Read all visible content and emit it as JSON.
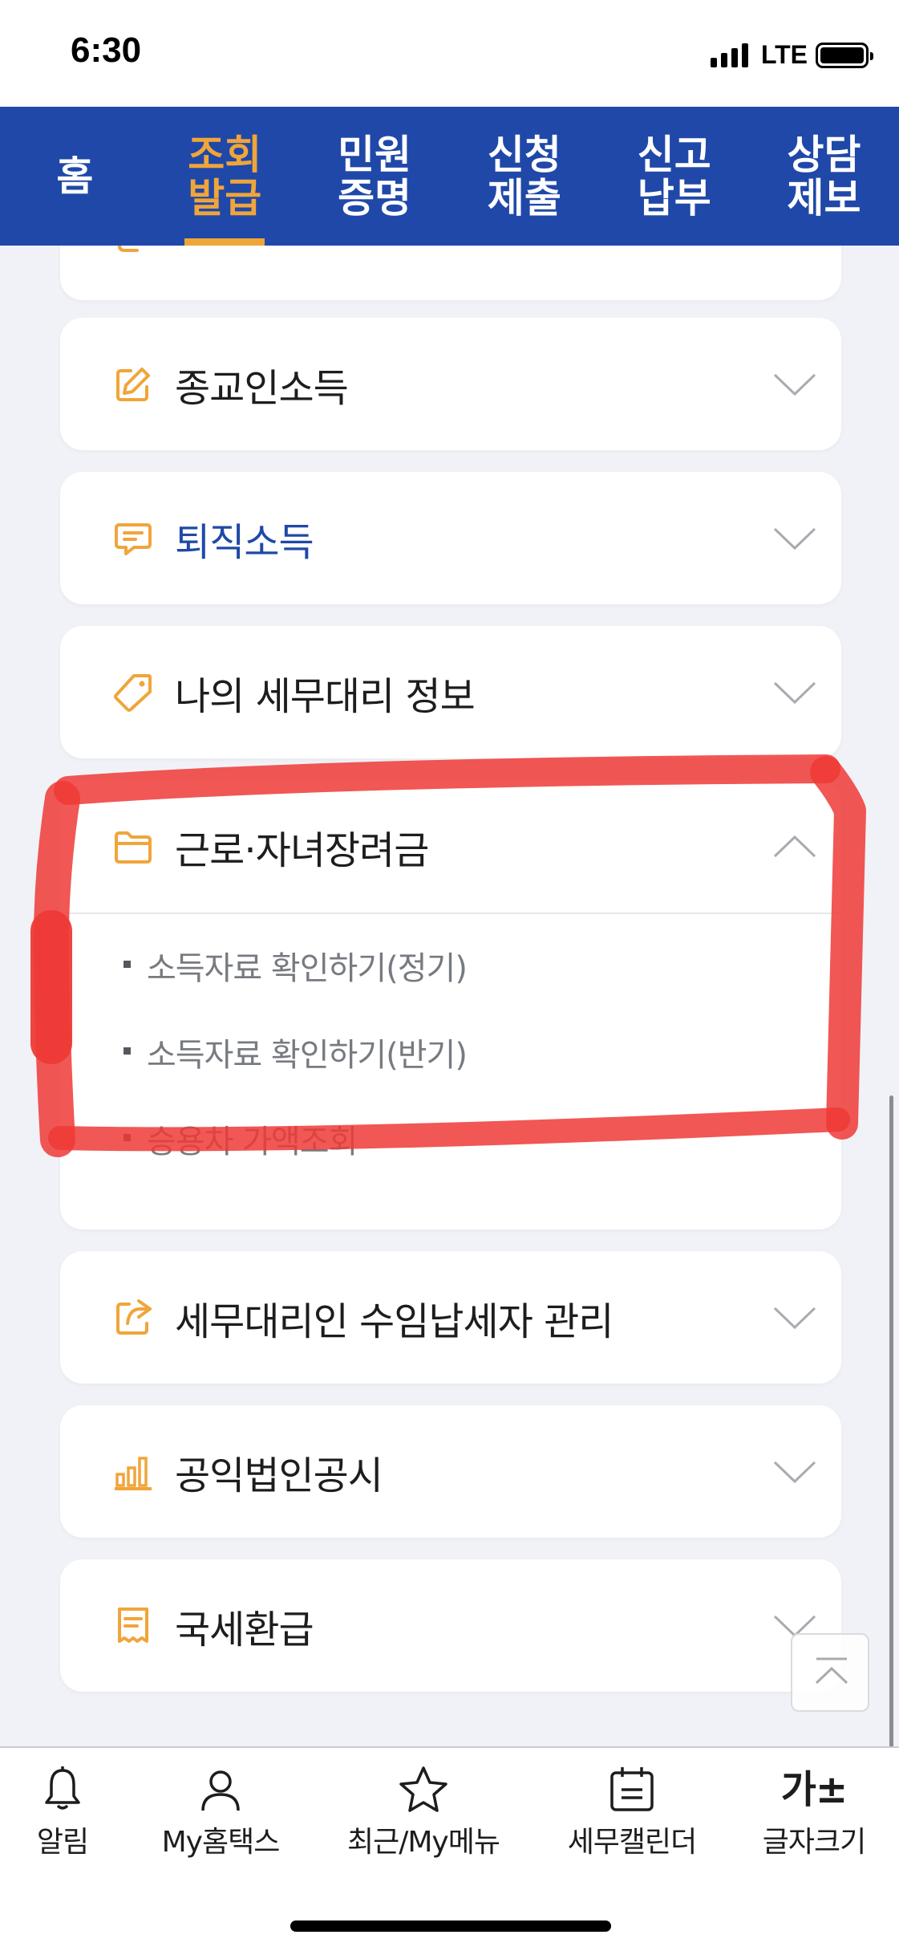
{
  "status_bar": {
    "time": "6:30",
    "network": "LTE"
  },
  "top_nav": {
    "items": [
      {
        "label": "홈"
      },
      {
        "label": "조회\n발급",
        "active": true
      },
      {
        "label": "민원\n증명"
      },
      {
        "label": "신청\n제출"
      },
      {
        "label": "신고\n납부"
      },
      {
        "label": "상담\n제보"
      }
    ]
  },
  "menu": {
    "cards": [
      {
        "title": "종교인소득",
        "icon": "edit-icon",
        "expanded": false
      },
      {
        "title": "퇴직소득",
        "icon": "message-icon",
        "expanded": false,
        "highlight": true
      },
      {
        "title": "나의 세무대리 정보",
        "icon": "tag-icon",
        "expanded": false
      },
      {
        "title": "근로·자녀장려금",
        "icon": "folder-icon",
        "expanded": true,
        "sub_items": [
          "소득자료 확인하기(정기)",
          "소득자료 확인하기(반기)",
          "승용차 가액조회"
        ]
      },
      {
        "title": "세무대리인 수임납세자 관리",
        "icon": "share-icon",
        "expanded": false
      },
      {
        "title": "공익법인공시",
        "icon": "bar-chart-icon",
        "expanded": false
      },
      {
        "title": "국세환급",
        "icon": "receipt-icon",
        "expanded": false
      }
    ]
  },
  "bottom_bar": {
    "tabs": [
      {
        "label": "알림",
        "icon": "bell-icon"
      },
      {
        "label": "My홈택스",
        "icon": "user-icon"
      },
      {
        "label": "최근/My메뉴",
        "icon": "star-icon"
      },
      {
        "label": "세무캘린더",
        "icon": "calendar-icon"
      },
      {
        "label": "글자크기",
        "icon": "font-size-icon",
        "icon_text": "가±"
      }
    ]
  },
  "colors": {
    "brand_blue": "#1f48a8",
    "accent_orange": "#f0a53a",
    "annotation_red": "#ee3a36"
  }
}
